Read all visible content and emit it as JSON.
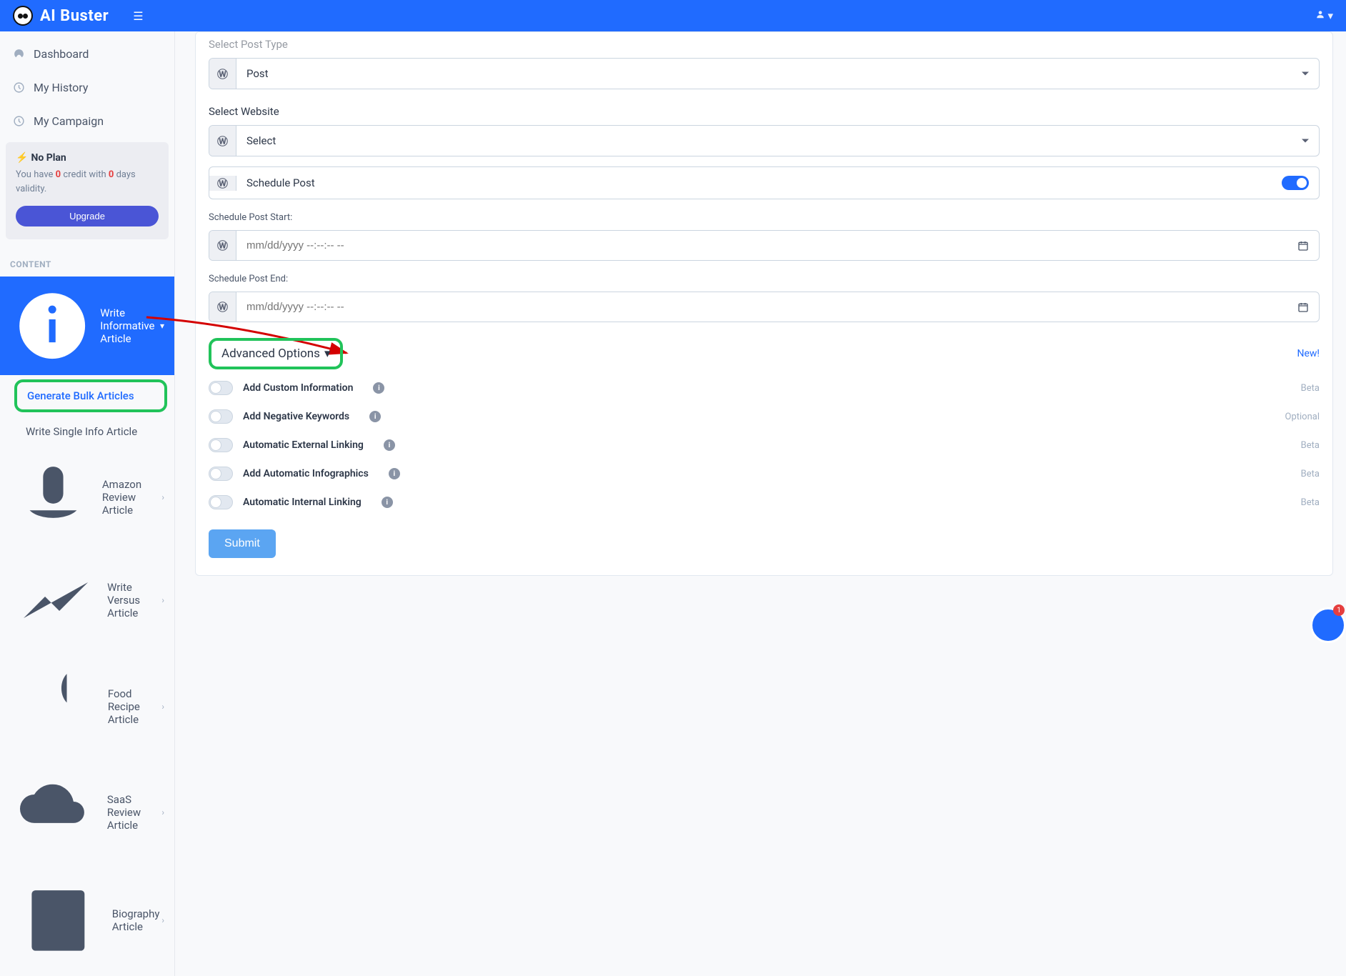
{
  "brand": "AI Buster",
  "sidebar": {
    "dashboard": "Dashboard",
    "history": "My History",
    "campaign": "My Campaign",
    "plan": {
      "title": "No Plan",
      "text_before": "You have ",
      "zero1": "0",
      "text_mid": " credit with ",
      "zero2": "0",
      "text_after": " days validity.",
      "upgrade": "Upgrade"
    },
    "content_label": "CONTENT",
    "write_informative": "Write Informative Article",
    "gen_bulk": "Generate Bulk Articles",
    "write_single": "Write Single Info Article",
    "amazon": "Amazon Review Article",
    "versus": "Write Versus Article",
    "food": "Food Recipe Article",
    "saas": "SaaS Review Article",
    "bio": "Biography Article"
  },
  "form": {
    "post_type_label": "Select Post Type",
    "post_type_value": "Post",
    "website_label": "Select Website",
    "website_value": "Select",
    "schedule_post": "Schedule Post",
    "sched_start": "Schedule Post Start:",
    "sched_end": "Schedule Post End:",
    "date_placeholder": "mm/dd/yyyy --:--:-- --",
    "advanced": "Advanced Options",
    "new": "New!",
    "options": [
      {
        "label": "Add Custom Information",
        "tag": "Beta"
      },
      {
        "label": "Add Negative Keywords",
        "tag": "Optional"
      },
      {
        "label": "Automatic External Linking",
        "tag": "Beta"
      },
      {
        "label": "Add Automatic Infographics",
        "tag": "Beta"
      },
      {
        "label": "Automatic Internal Linking",
        "tag": "Beta"
      }
    ],
    "submit": "Submit"
  },
  "float_badge": "1"
}
